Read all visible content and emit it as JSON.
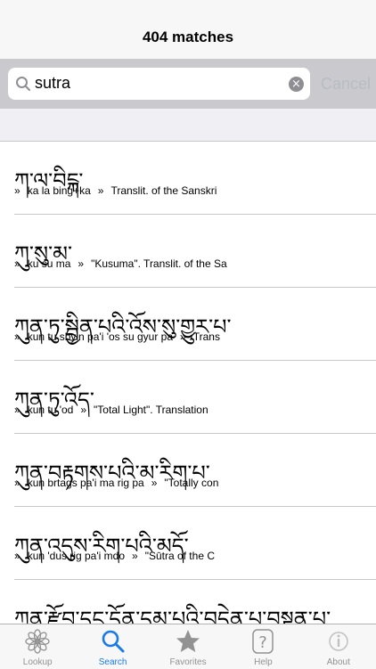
{
  "navbar": {
    "title": "404 matches"
  },
  "search": {
    "query": "sutra",
    "cancel_label": "Cancel",
    "clear_icon": "×"
  },
  "results": [
    {
      "tibetan": "ཀ་ལ་བིངྐ་",
      "wylie": "ka la bing+ka",
      "gloss": "Translit. of the Sanskri"
    },
    {
      "tibetan": "ཀུ་སུ་མ་",
      "wylie": "ku su ma",
      "gloss": "\"Kusuma\". Translit. of the Sa"
    },
    {
      "tibetan": "ཀུན་ཏུ་སྦྱིན་པའི་འོས་སུ་གྱུར་པ་",
      "wylie": "kun tu sbyin pa'i 'os su gyur pa",
      "gloss": "Trans"
    },
    {
      "tibetan": "ཀུན་ཏུ་འོད་",
      "wylie": "kun tu 'od",
      "gloss": "\"Total Light\". Translation"
    },
    {
      "tibetan": "ཀུན་བརྟགས་པའི་མ་རིག་པ་",
      "wylie": "kun brtags pa'i ma rig pa",
      "gloss": "\"Totally con"
    },
    {
      "tibetan": "ཀུན་འདུས་རིག་པའི་མདོ་",
      "wylie": "kun 'dus rig pa'i mdo",
      "gloss": "\"Sūtra of the C"
    },
    {
      "tibetan": "ཀུན་རྫོབ་དང་དོན་དམ་པའི་བདེན་པ་བསྟན་པ་",
      "wylie": "",
      "gloss": ""
    }
  ],
  "row_marker": "»",
  "tabs": [
    {
      "label": "Lookup",
      "icon": "lotus-icon",
      "active": false
    },
    {
      "label": "Search",
      "icon": "magnifier-icon",
      "active": true
    },
    {
      "label": "Favorites",
      "icon": "star-icon",
      "active": false
    },
    {
      "label": "Help",
      "icon": "question-icon",
      "active": false
    },
    {
      "label": "About",
      "icon": "info-icon",
      "active": false
    }
  ],
  "colors": {
    "accent": "#1a7ae8",
    "inactive": "#929292"
  }
}
